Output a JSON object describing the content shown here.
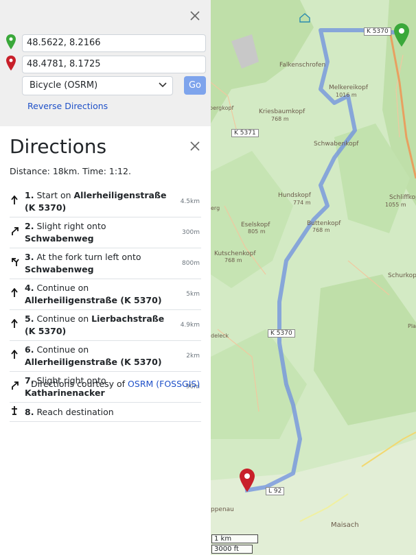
{
  "search": {
    "from_value": "48.5622, 8.2166",
    "to_value": "48.4781, 8.1725",
    "engine": "Bicycle (OSRM)",
    "go_label": "Go",
    "reverse_label": "Reverse Directions"
  },
  "directions": {
    "title": "Directions",
    "summary": "Distance: 18km. Time: 1:12.",
    "steps": [
      {
        "icon": "straight-icon",
        "num": "1.",
        "text": "Start on ",
        "road": "Allerheiligenstraße (K 5370)",
        "dist": "4.5km"
      },
      {
        "icon": "slight-right-icon",
        "num": "2.",
        "text": "Slight right onto ",
        "road": "Schwabenweg",
        "dist": "300m"
      },
      {
        "icon": "fork-left-icon",
        "num": "3.",
        "text": "At the fork turn left onto ",
        "road": "Schwabenweg",
        "dist": "800m"
      },
      {
        "icon": "straight-icon",
        "num": "4.",
        "text": "Continue on ",
        "road": "Allerheiligenstraße (K 5370)",
        "dist": "5km"
      },
      {
        "icon": "straight-icon",
        "num": "5.",
        "text": "Continue on ",
        "road": "Lierbachstraße (K 5370)",
        "dist": "4.9km"
      },
      {
        "icon": "straight-icon",
        "num": "6.",
        "text": "Continue on ",
        "road": "Allerheiligenstraße (K 5370)",
        "dist": "2km"
      },
      {
        "icon": "slight-right-icon",
        "num": "7.",
        "text": "Slight right onto ",
        "road": "Katharinenacker",
        "dist": "90m"
      },
      {
        "icon": "destination-icon",
        "num": "8.",
        "text": "Reach destination",
        "road": "",
        "dist": ""
      }
    ],
    "courtesy_prefix": "Directions courtesy of ",
    "courtesy_link": "OSRM (FOSSGIS)"
  },
  "map": {
    "labels": [
      {
        "text": "Falkenschrofen"
      },
      {
        "text": "Melkereikopf"
      },
      {
        "text": "1016 m"
      },
      {
        "text": "Kriesbaumkopf"
      },
      {
        "text": "768 m"
      },
      {
        "text": "bergkopf"
      },
      {
        "text": "Schwabenkopf"
      },
      {
        "text": "Hundskopf"
      },
      {
        "text": "774 m"
      },
      {
        "text": "Buttenkopf"
      },
      {
        "text": "768 m"
      },
      {
        "text": "Eselskopf"
      },
      {
        "text": "805 m"
      },
      {
        "text": "Kutschenkopf"
      },
      {
        "text": "768 m"
      },
      {
        "text": "Schliffkopf"
      },
      {
        "text": "1055 m"
      },
      {
        "text": "Schurkopf"
      },
      {
        "text": "Maisach"
      },
      {
        "text": "ppenau"
      },
      {
        "text": "deleck"
      },
      {
        "text": "Plank"
      },
      {
        "text": "erg"
      }
    ],
    "road_tags": [
      "K 5370",
      "K 5371",
      "K 5370",
      "L 92"
    ],
    "scale_km": "1 km",
    "scale_ft": "3000 ft"
  },
  "colors": {
    "route": "#6e8fe0",
    "start_pin": "#3aa83a",
    "end_pin": "#c8202a",
    "go_button": "#7ea4ec"
  }
}
